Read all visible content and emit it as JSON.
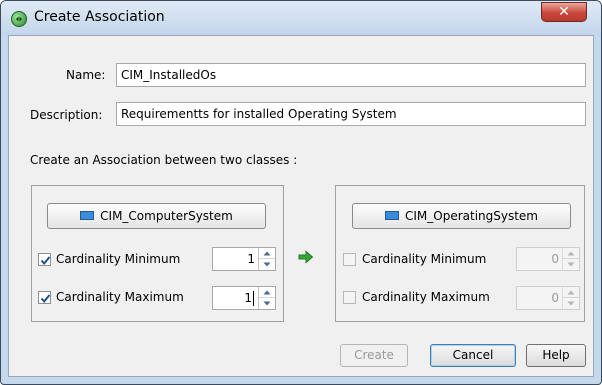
{
  "window": {
    "title": "Create Association",
    "close_symbol": "✕"
  },
  "form": {
    "name_label": "Name:",
    "name_value": "CIM_InstalledOs",
    "description_label": "Description:",
    "description_value": "Requirementts for installed Operating System",
    "section_label": "Create an Association between two classes :"
  },
  "left": {
    "class_button": "CIM_ComputerSystem",
    "card_min_label": "Cardinality Minimum",
    "card_min_checked": true,
    "card_min_value": "1",
    "card_max_label": "Cardinality Maximum",
    "card_max_checked": true,
    "card_max_value": "1"
  },
  "right": {
    "class_button": "CIM_OperatingSystem",
    "card_min_label": "Cardinality Minimum",
    "card_min_checked": false,
    "card_min_value": "0",
    "card_max_label": "Cardinality Maximum",
    "card_max_checked": false,
    "card_max_value": "0"
  },
  "buttons": {
    "create": "Create",
    "cancel": "Cancel",
    "help": "Help"
  },
  "colors": {
    "arrow": "#3aa536",
    "title_bar": "#c5d8ec",
    "close_button": "#c9463a"
  }
}
